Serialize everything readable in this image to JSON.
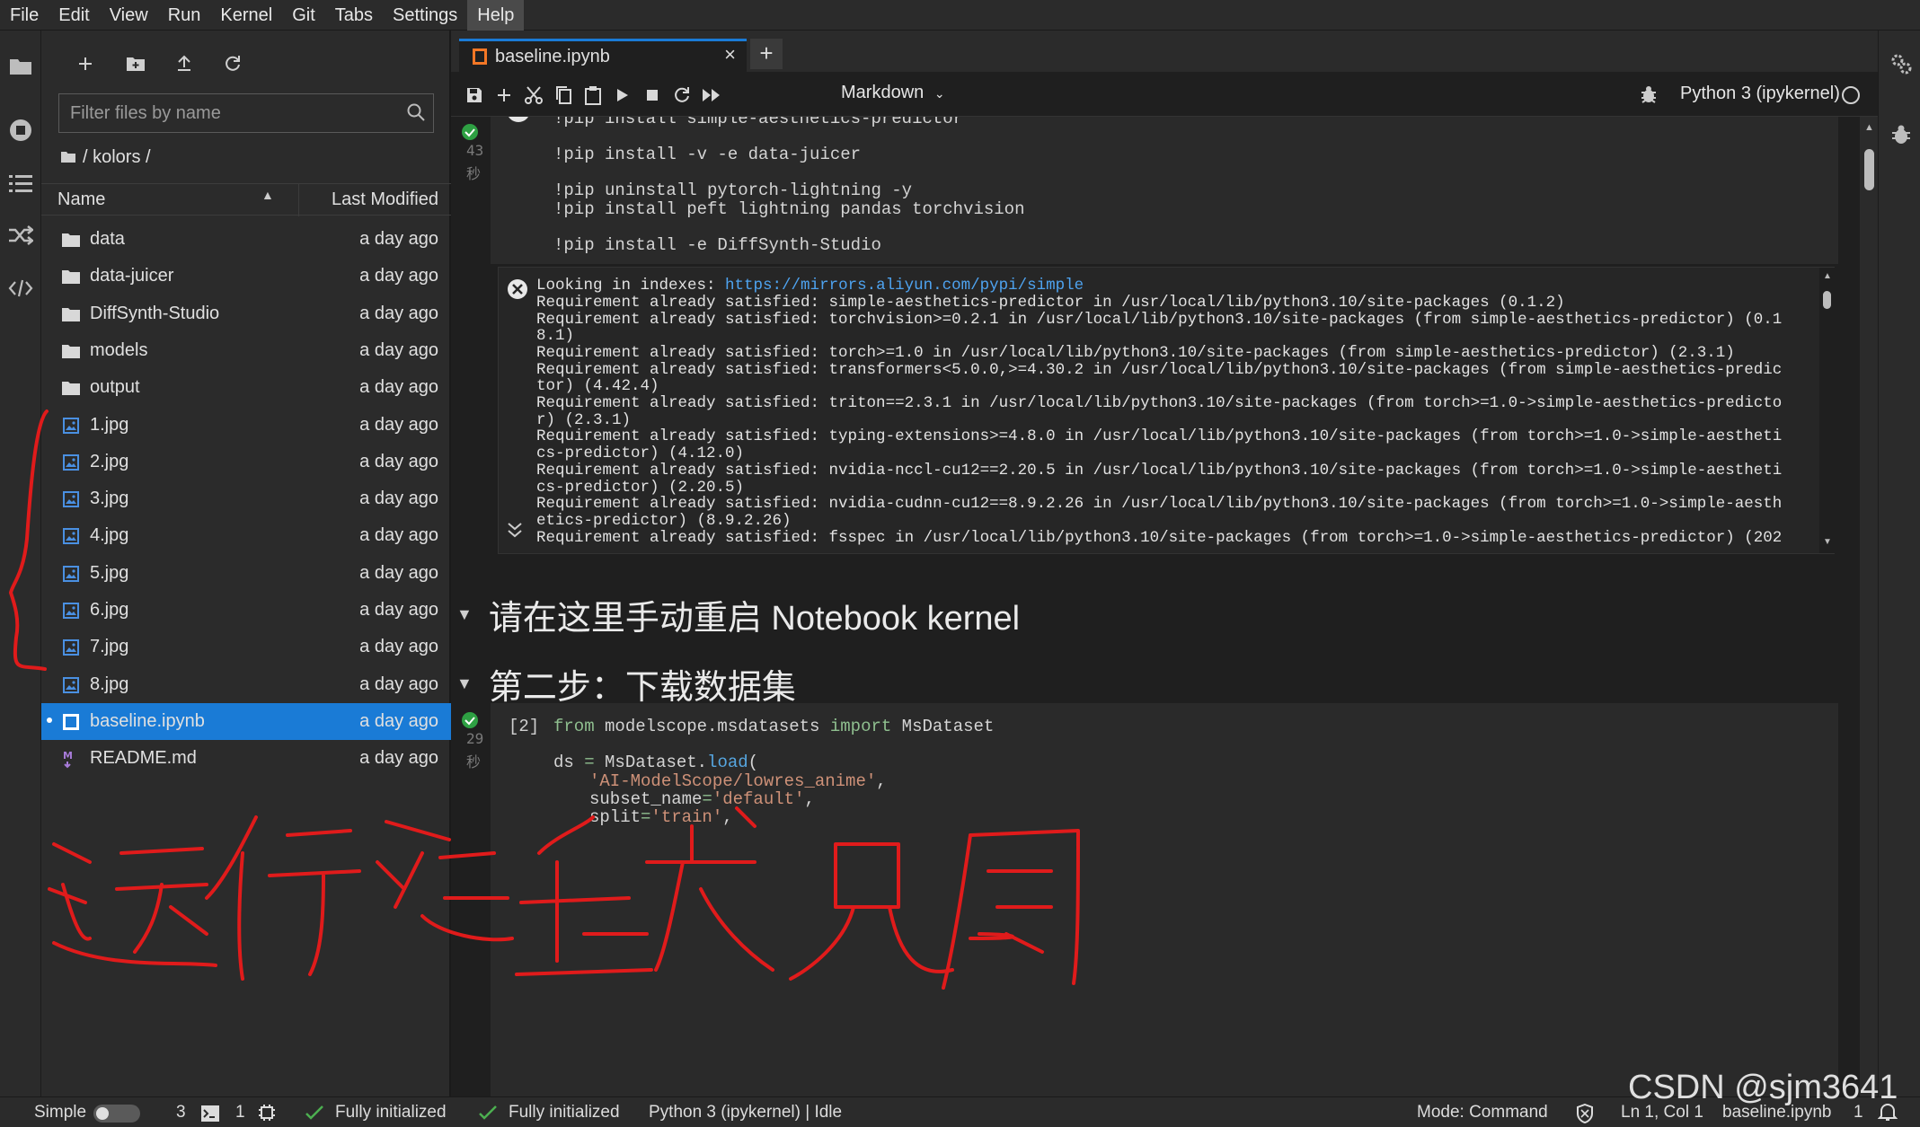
{
  "menu": [
    "File",
    "Edit",
    "View",
    "Run",
    "Kernel",
    "Git",
    "Tabs",
    "Settings",
    "Help"
  ],
  "filebrowser": {
    "filter_placeholder": "Filter files by name",
    "breadcrumb": "/ kolors /",
    "col_name": "Name",
    "col_modified": "Last Modified",
    "files": [
      {
        "name": "data",
        "modified": "a day ago",
        "icon": "folder-icon"
      },
      {
        "name": "data-juicer",
        "modified": "a day ago",
        "icon": "folder-icon"
      },
      {
        "name": "DiffSynth-Studio",
        "modified": "a day ago",
        "icon": "folder-icon"
      },
      {
        "name": "models",
        "modified": "a day ago",
        "icon": "folder-icon"
      },
      {
        "name": "output",
        "modified": "a day ago",
        "icon": "folder-icon"
      },
      {
        "name": "1.jpg",
        "modified": "a day ago",
        "icon": "image-file-icon"
      },
      {
        "name": "2.jpg",
        "modified": "a day ago",
        "icon": "image-file-icon"
      },
      {
        "name": "3.jpg",
        "modified": "a day ago",
        "icon": "image-file-icon"
      },
      {
        "name": "4.jpg",
        "modified": "a day ago",
        "icon": "image-file-icon"
      },
      {
        "name": "5.jpg",
        "modified": "a day ago",
        "icon": "image-file-icon"
      },
      {
        "name": "6.jpg",
        "modified": "a day ago",
        "icon": "image-file-icon"
      },
      {
        "name": "7.jpg",
        "modified": "a day ago",
        "icon": "image-file-icon"
      },
      {
        "name": "8.jpg",
        "modified": "a day ago",
        "icon": "image-file-icon"
      },
      {
        "name": "baseline.ipynb",
        "modified": "a day ago",
        "icon": "notebook-icon",
        "selected": true
      },
      {
        "name": "README.md",
        "modified": "a day ago",
        "icon": "markdown-icon"
      }
    ]
  },
  "tab": {
    "label": "baseline.ipynb",
    "close": "×",
    "new": "+"
  },
  "toolbar": {
    "cell_type": "Markdown",
    "kernel": "Python 3 (ipykernel)"
  },
  "cell1": {
    "time_value": "43",
    "time_unit": "秒",
    "lines": {
      "l0": "!pip install simple-aesthetics-predictor",
      "l1": "!pip install -v -e data-juicer",
      "l2": "!pip uninstall pytorch-lightning -y",
      "l3": "!pip install peft lightning pandas torchvision",
      "l4": "!pip install -e DiffSynth-Studio"
    }
  },
  "output": {
    "l0a": "Looking in indexes: ",
    "l0b": "https://mirrors.aliyun.com/pypi/simple",
    "l1": "Requirement already satisfied: simple-aesthetics-predictor in /usr/local/lib/python3.10/site-packages (0.1.2)",
    "l2": "Requirement already satisfied: torchvision>=0.2.1 in /usr/local/lib/python3.10/site-packages (from simple-aesthetics-predictor) (0.1",
    "l3": "8.1)",
    "l4": "Requirement already satisfied: torch>=1.0 in /usr/local/lib/python3.10/site-packages (from simple-aesthetics-predictor) (2.3.1)",
    "l5": "Requirement already satisfied: transformers<5.0.0,>=4.30.2 in /usr/local/lib/python3.10/site-packages (from simple-aesthetics-predic",
    "l6": "tor) (4.42.4)",
    "l7": "Requirement already satisfied: triton==2.3.1 in /usr/local/lib/python3.10/site-packages (from torch>=1.0->simple-aesthetics-predicto",
    "l8": "r) (2.3.1)",
    "l9": "Requirement already satisfied: typing-extensions>=4.8.0 in /usr/local/lib/python3.10/site-packages (from torch>=1.0->simple-aestheti",
    "l10": "cs-predictor) (4.12.0)",
    "l11": "Requirement already satisfied: nvidia-nccl-cu12==2.20.5 in /usr/local/lib/python3.10/site-packages (from torch>=1.0->simple-aestheti",
    "l12": "cs-predictor) (2.20.5)",
    "l13": "Requirement already satisfied: nvidia-cudnn-cu12==8.9.2.26 in /usr/local/lib/python3.10/site-packages (from torch>=1.0->simple-aesth",
    "l14": "etics-predictor) (8.9.2.26)",
    "l15": "Requirement already satisfied: fsspec in /usr/local/lib/python3.10/site-packages (from torch>=1.0->simple-aesthetics-predictor) (202"
  },
  "md1": "请在这里手动重启 Notebook kernel",
  "md2": "第二步：下载数据集",
  "cell2": {
    "prompt": "[2]",
    "time_value": "29",
    "time_unit": "秒",
    "l0_from": "from",
    "l0_mod": " modelscope.msdatasets ",
    "l0_import": "import",
    "l0_cls": " MsDataset",
    "l1_ds": "ds ",
    "l1_eq": "=",
    "l1_rest": " MsDataset.",
    "l1_load": "load",
    "l1_paren": "(",
    "l2": "'AI-ModelScope/lowres_anime'",
    "l2_comma": ",",
    "l3_key": "subset_name",
    "l3_eq": "=",
    "l3_val": "'default'",
    "l3_comma": ",",
    "l4_key": "split",
    "l4_eq": "=",
    "l4_val": "'train'",
    "l4_comma": ","
  },
  "status": {
    "mode_label": "Simple",
    "count1": "3",
    "count2": "1",
    "init1": "Fully initialized",
    "init2": "Fully initialized",
    "kernel": "Python 3 (ipykernel) | Idle",
    "mode": "Mode: Command",
    "cursor": "Ln 1, Col 1",
    "file": "baseline.ipynb",
    "notif": "1"
  },
  "watermark": "CSDN @sjm3641",
  "colors": {
    "accent": "#1a7bd6",
    "annotation": "#e01b1b",
    "success": "#2ea043"
  }
}
